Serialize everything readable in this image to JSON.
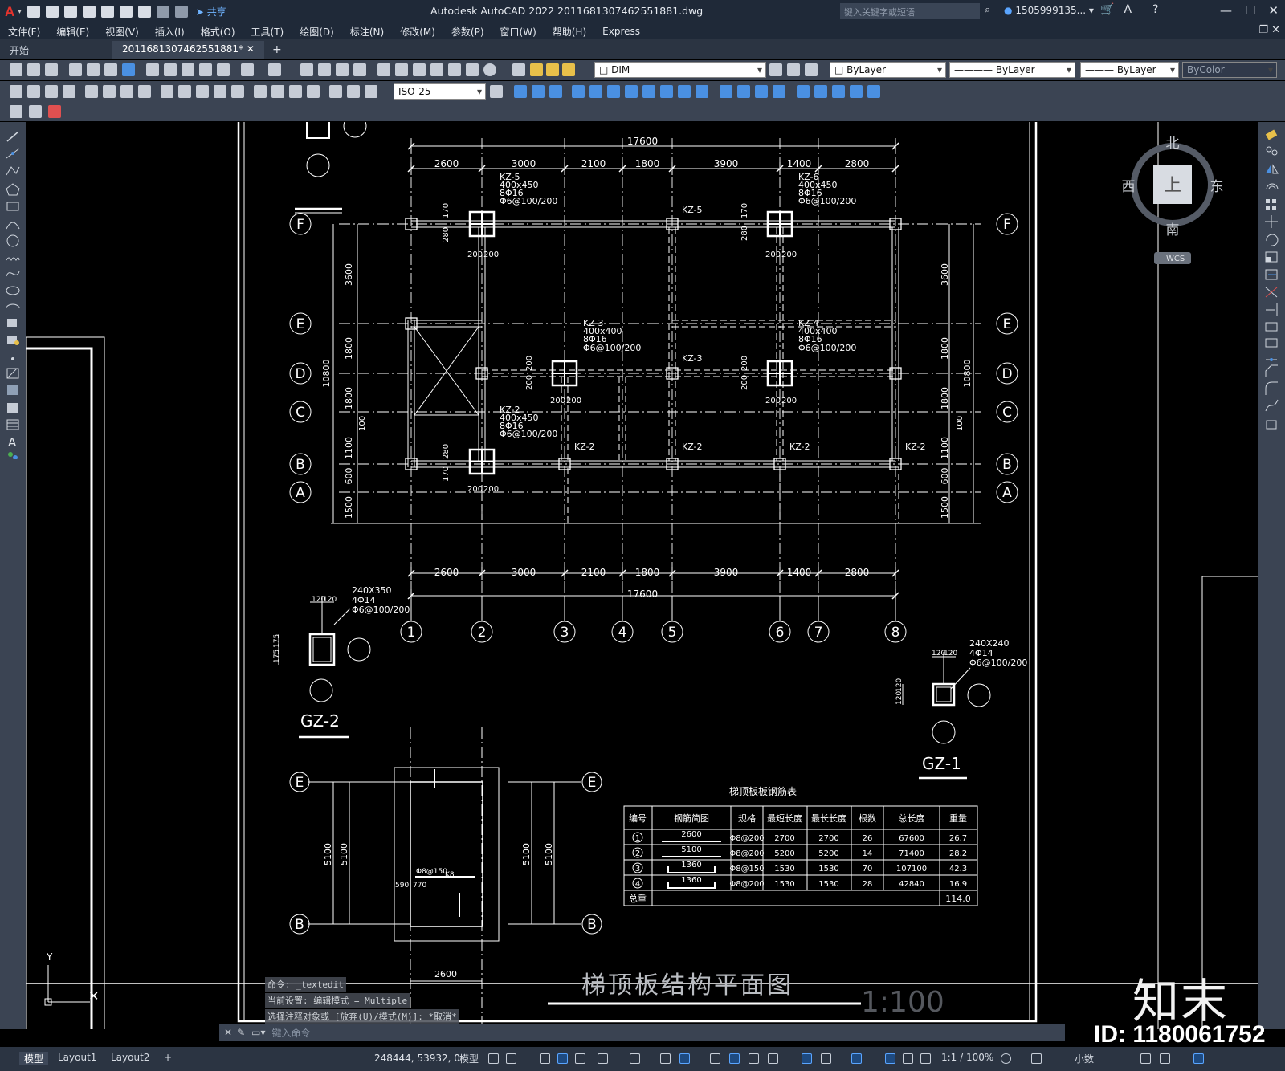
{
  "app": {
    "title": "Autodesk AutoCAD 2022    2011681307462551881.dwg",
    "share_label": "共享",
    "search_placeholder": "键入关键字或短语",
    "user": "1505999135... ▾",
    "logo": "A"
  },
  "menu": [
    "文件(F)",
    "编辑(E)",
    "视图(V)",
    "插入(I)",
    "格式(O)",
    "工具(T)",
    "绘图(D)",
    "标注(N)",
    "修改(M)",
    "参数(P)",
    "窗口(W)",
    "帮助(H)",
    "Express"
  ],
  "tabs": [
    {
      "label": "开始"
    },
    {
      "label": "2011681307462551881*"
    }
  ],
  "toolbar": {
    "text_style": "DIM",
    "dim_style": "ISO-25",
    "color": "ByLayer",
    "linetype": "ByLayer",
    "lineweight": "ByLayer",
    "plotstyle": "ByColor"
  },
  "viewcube": {
    "north": "北",
    "south": "南",
    "east": "东",
    "west": "西",
    "top": "上",
    "wcs": "WCS"
  },
  "command": {
    "history": [
      "命令: _textedit",
      "当前设置: 编辑模式 = Multiple",
      "选择注释对象或 [放弃(U)/模式(M)]: *取消*"
    ],
    "placeholder": "键入命令"
  },
  "status": {
    "tabs": [
      "模型",
      "Layout1",
      "Layout2"
    ],
    "coordinates": "248444, 53932, 0",
    "model": "模型",
    "scale": "1:1 / 100%",
    "units": "小数"
  },
  "drawing": {
    "dims_top_total": "17600",
    "dims_top": [
      "2600",
      "3000",
      "2100",
      "1800",
      "3900",
      "1400",
      "2800"
    ],
    "axes_col": [
      "1",
      "2",
      "3",
      "4",
      "5",
      "6",
      "7",
      "8"
    ],
    "axes_row": [
      "F",
      "E",
      "D",
      "C",
      "B",
      "A"
    ],
    "dims_side": [
      "3600",
      "1800",
      "1800",
      "1100",
      "600",
      "1500"
    ],
    "dims_side_total": "10800",
    "col_labels": [
      {
        "id": "KZ-5",
        "size": "400x450",
        "bars": "8Φ16",
        "ties": "Φ6@100/200"
      },
      {
        "id": "KZ-6",
        "size": "400x450",
        "bars": "8Φ16",
        "ties": "Φ6@100/200"
      },
      {
        "id": "KZ-3",
        "size": "400x400",
        "bars": "8Φ16",
        "ties": "Φ6@100/200"
      },
      {
        "id": "KZ-4",
        "size": "400x400",
        "bars": "8Φ16",
        "ties": "Φ6@100/200"
      },
      {
        "id": "KZ-2",
        "size": "400x450",
        "bars": "8Φ16",
        "ties": "Φ6@100/200"
      }
    ],
    "small_labels": [
      "KZ-5",
      "KZ-3",
      "KZ-2",
      "KZ-2",
      "KZ-2",
      "KZ-2",
      "200",
      "200",
      "280",
      "170",
      "100",
      "240X350",
      "4Φ14",
      "Φ6@100/200",
      "240X240",
      "4Φ14",
      "Φ6@100/200",
      "120",
      "175"
    ],
    "gz2": "GZ-2",
    "gz1": "GZ-1",
    "stair_dims": [
      "5100",
      "5100",
      "5100",
      "5100",
      "2600"
    ],
    "stair_marks": [
      "Φ8@150",
      "K8",
      "590",
      "770"
    ],
    "plan_title": "梯顶板结构平面图",
    "plan_scale": "1:100",
    "table_title": "梯顶板板钢筋表",
    "table_headers": [
      "编号",
      "钢筋简图",
      "规格",
      "最短长度",
      "最长长度",
      "根数",
      "总长度",
      "重量"
    ],
    "table_rows": [
      {
        "no": "1",
        "sketch": "2600",
        "spec": "Φ8@200",
        "min": "2700",
        "max": "2700",
        "count": "26",
        "total": "67600",
        "weight": "26.7"
      },
      {
        "no": "2",
        "sketch": "5100",
        "spec": "Φ8@200",
        "min": "5200",
        "max": "5200",
        "count": "14",
        "total": "71400",
        "weight": "28.2"
      },
      {
        "no": "3",
        "sketch": "1360",
        "spec": "Φ8@150",
        "min": "1530",
        "max": "1530",
        "count": "70",
        "total": "107100",
        "weight": "42.3"
      },
      {
        "no": "4",
        "sketch": "1360",
        "spec": "Φ8@200",
        "min": "1530",
        "max": "1530",
        "count": "28",
        "total": "42840",
        "weight": "16.9"
      }
    ],
    "table_total_label": "总重",
    "table_total": "114.0",
    "ucs_y": "Y"
  },
  "watermark": {
    "logo": "知末",
    "id": "ID: 1180061752"
  },
  "colors": {
    "chrome": "#1f2938",
    "toolbar": "#3b4453",
    "canvas": "#000000",
    "line": "#ffffff",
    "accent": "#4a90e2"
  }
}
